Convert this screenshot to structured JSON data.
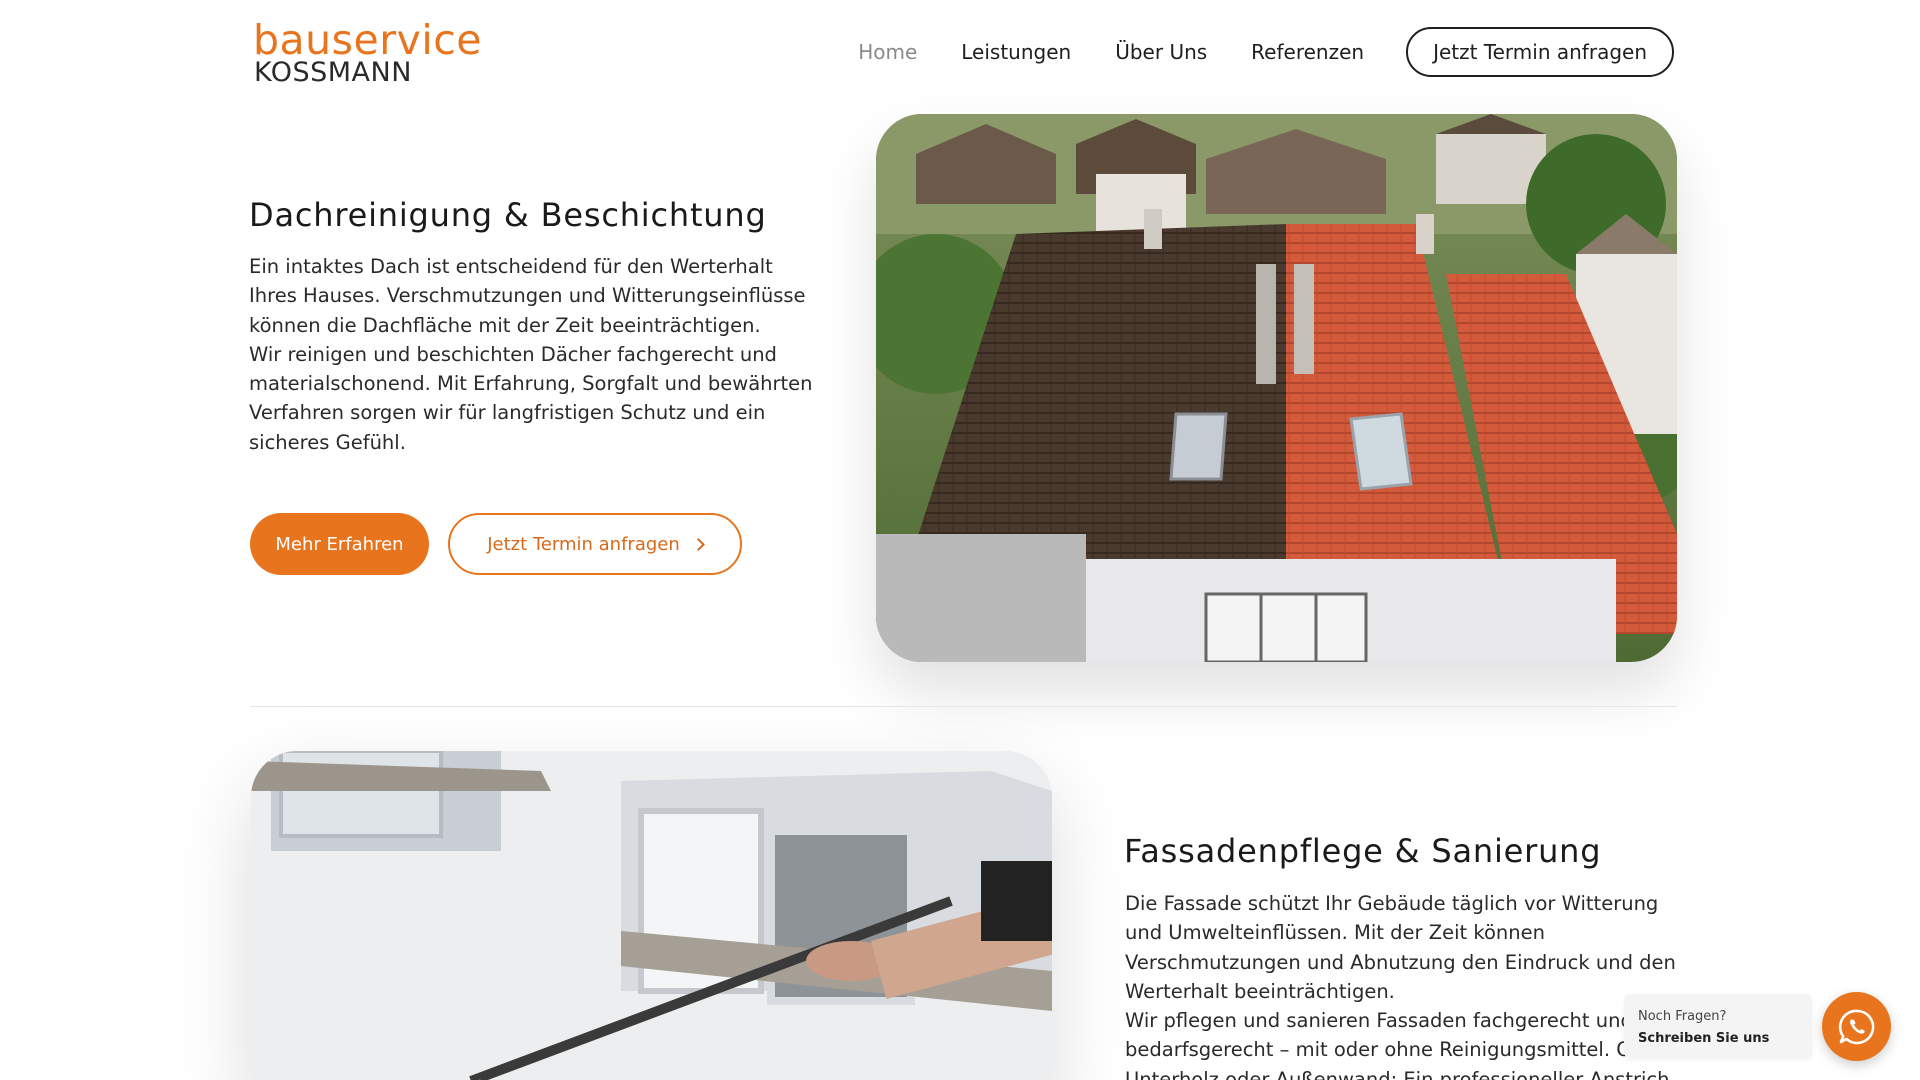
{
  "header": {
    "logo_top": "bauservice",
    "logo_bottom": "KOSSMANN",
    "nav": [
      {
        "label": "Home",
        "active": true
      },
      {
        "label": "Leistungen"
      },
      {
        "label": "Über Uns"
      },
      {
        "label": "Referenzen"
      }
    ],
    "cta_label": "Jetzt Termin anfragen"
  },
  "section1": {
    "title": "Dachreinigung & Beschichtung",
    "paragraph1": "Ein intaktes Dach ist entscheidend für den Werterhalt Ihres Hauses. Verschmutzungen und Witterungseinflüsse können die Dachfläche mit der Zeit beeinträchtigen.",
    "paragraph2": "Wir reinigen und beschichten Dächer fachgerecht und materialschonend. Mit Erfahrung, Sorgfalt und bewährten Verfahren sorgen wir für langfristigen Schutz und ein sicheres Gefühl.",
    "primary_button": "Mehr Erfahren",
    "secondary_button": "Jetzt Termin anfragen",
    "image_icon": "roof-photo"
  },
  "section2": {
    "title": "Fassadenpflege & Sanierung",
    "paragraph1": "Die Fassade schützt Ihr Gebäude täglich vor Witterung und Umwelteinflüssen. Mit der Zeit können Verschmutzungen und Abnutzung den Eindruck und den Werterhalt beeinträchtigen.",
    "paragraph2": "Wir pflegen und sanieren Fassaden fachgerecht und bedarfsgerecht – mit oder ohne Reinigungsmittel. Ob Unterholz oder Außenwand: Ein professioneller Anstrich",
    "image_icon": "facade-cleaning-photo"
  },
  "chat": {
    "text_normal": "Noch Fragen? ",
    "text_bold": "Schreiben Sie uns",
    "icon": "whatsapp-icon"
  },
  "colors": {
    "accent": "#e8751d",
    "text": "#1f1f1f",
    "nav_active": "#8a8a8a"
  }
}
